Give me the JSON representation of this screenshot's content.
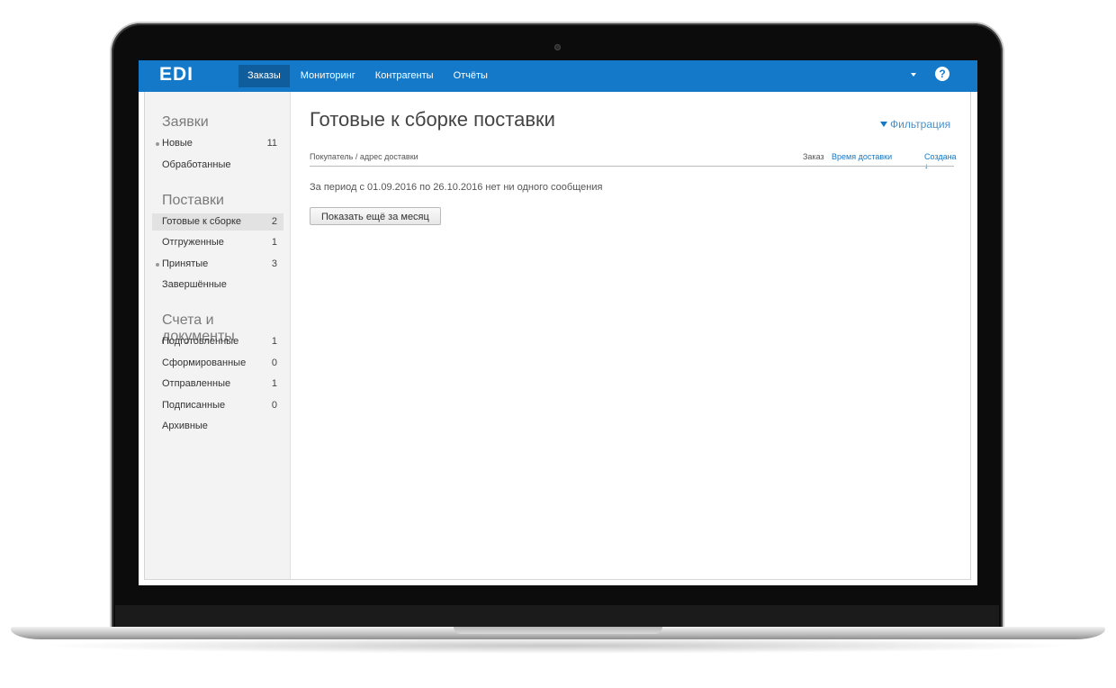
{
  "app": {
    "logo": "EDI",
    "nav": [
      "Заказы",
      "Мониторинг",
      "Контрагенты",
      "Отчёты"
    ],
    "help": "?"
  },
  "sidebar": {
    "orders": {
      "title": "Заявки",
      "items": [
        {
          "label": "Новые",
          "count": "11"
        },
        {
          "label": "Обработанные",
          "count": ""
        }
      ]
    },
    "deliveries": {
      "title": "Поставки",
      "items": [
        {
          "label": "Готовые к сборке",
          "count": "2"
        },
        {
          "label": "Отгруженные",
          "count": "1"
        },
        {
          "label": "Принятые",
          "count": "3"
        },
        {
          "label": "Завершённые",
          "count": ""
        }
      ]
    },
    "documents": {
      "title": "Счета и документы",
      "items": [
        {
          "label": "Подготовленные",
          "count": "1"
        },
        {
          "label": "Сформированные",
          "count": "0"
        },
        {
          "label": "Отправленные",
          "count": "1"
        },
        {
          "label": "Подписанные",
          "count": "0"
        },
        {
          "label": "Архивные",
          "count": ""
        }
      ]
    }
  },
  "main": {
    "title": "Готовые к сборке поставки",
    "filter_label": "Фильтрация",
    "columns": {
      "buyer": "Покупатель / адрес доставки",
      "order": "Заказ",
      "delivery_time": "Время доставки",
      "created": "Создана ↓"
    },
    "empty_message": "За период с 01.09.2016 по 26.10.2016 нет ни одного сообщения",
    "more_button": "Показать ещё за месяц"
  },
  "colors": {
    "accent": "#1479c8",
    "nav_active": "#0f5d9d",
    "sidebar_bg": "#f3f3f3"
  }
}
